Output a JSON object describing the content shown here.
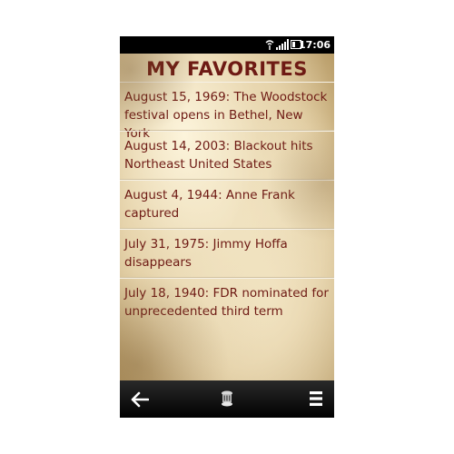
{
  "status_bar": {
    "time": "17:06",
    "icons": [
      "wifi-icon",
      "signal-icon",
      "battery-icon"
    ]
  },
  "page": {
    "title": "MY FAVORITES"
  },
  "favorites": [
    {
      "label": "August 15, 1969: The Woodstock festival opens in Bethel, New York"
    },
    {
      "label": "August 14, 2003: Blackout hits Northeast United States"
    },
    {
      "label": "August 4, 1944: Anne Frank captured"
    },
    {
      "label": "July 31, 1975: Jimmy Hoffa disappears"
    },
    {
      "label": "July 18, 1940: FDR nominated for unprecedented third term"
    }
  ],
  "nav_bar": {
    "icons": [
      "back-arrow-icon",
      "app-icon",
      "menu-icon"
    ]
  },
  "colors": {
    "text": "#6e1a14",
    "parchment": "#efe3c3",
    "bars": "#000000"
  }
}
